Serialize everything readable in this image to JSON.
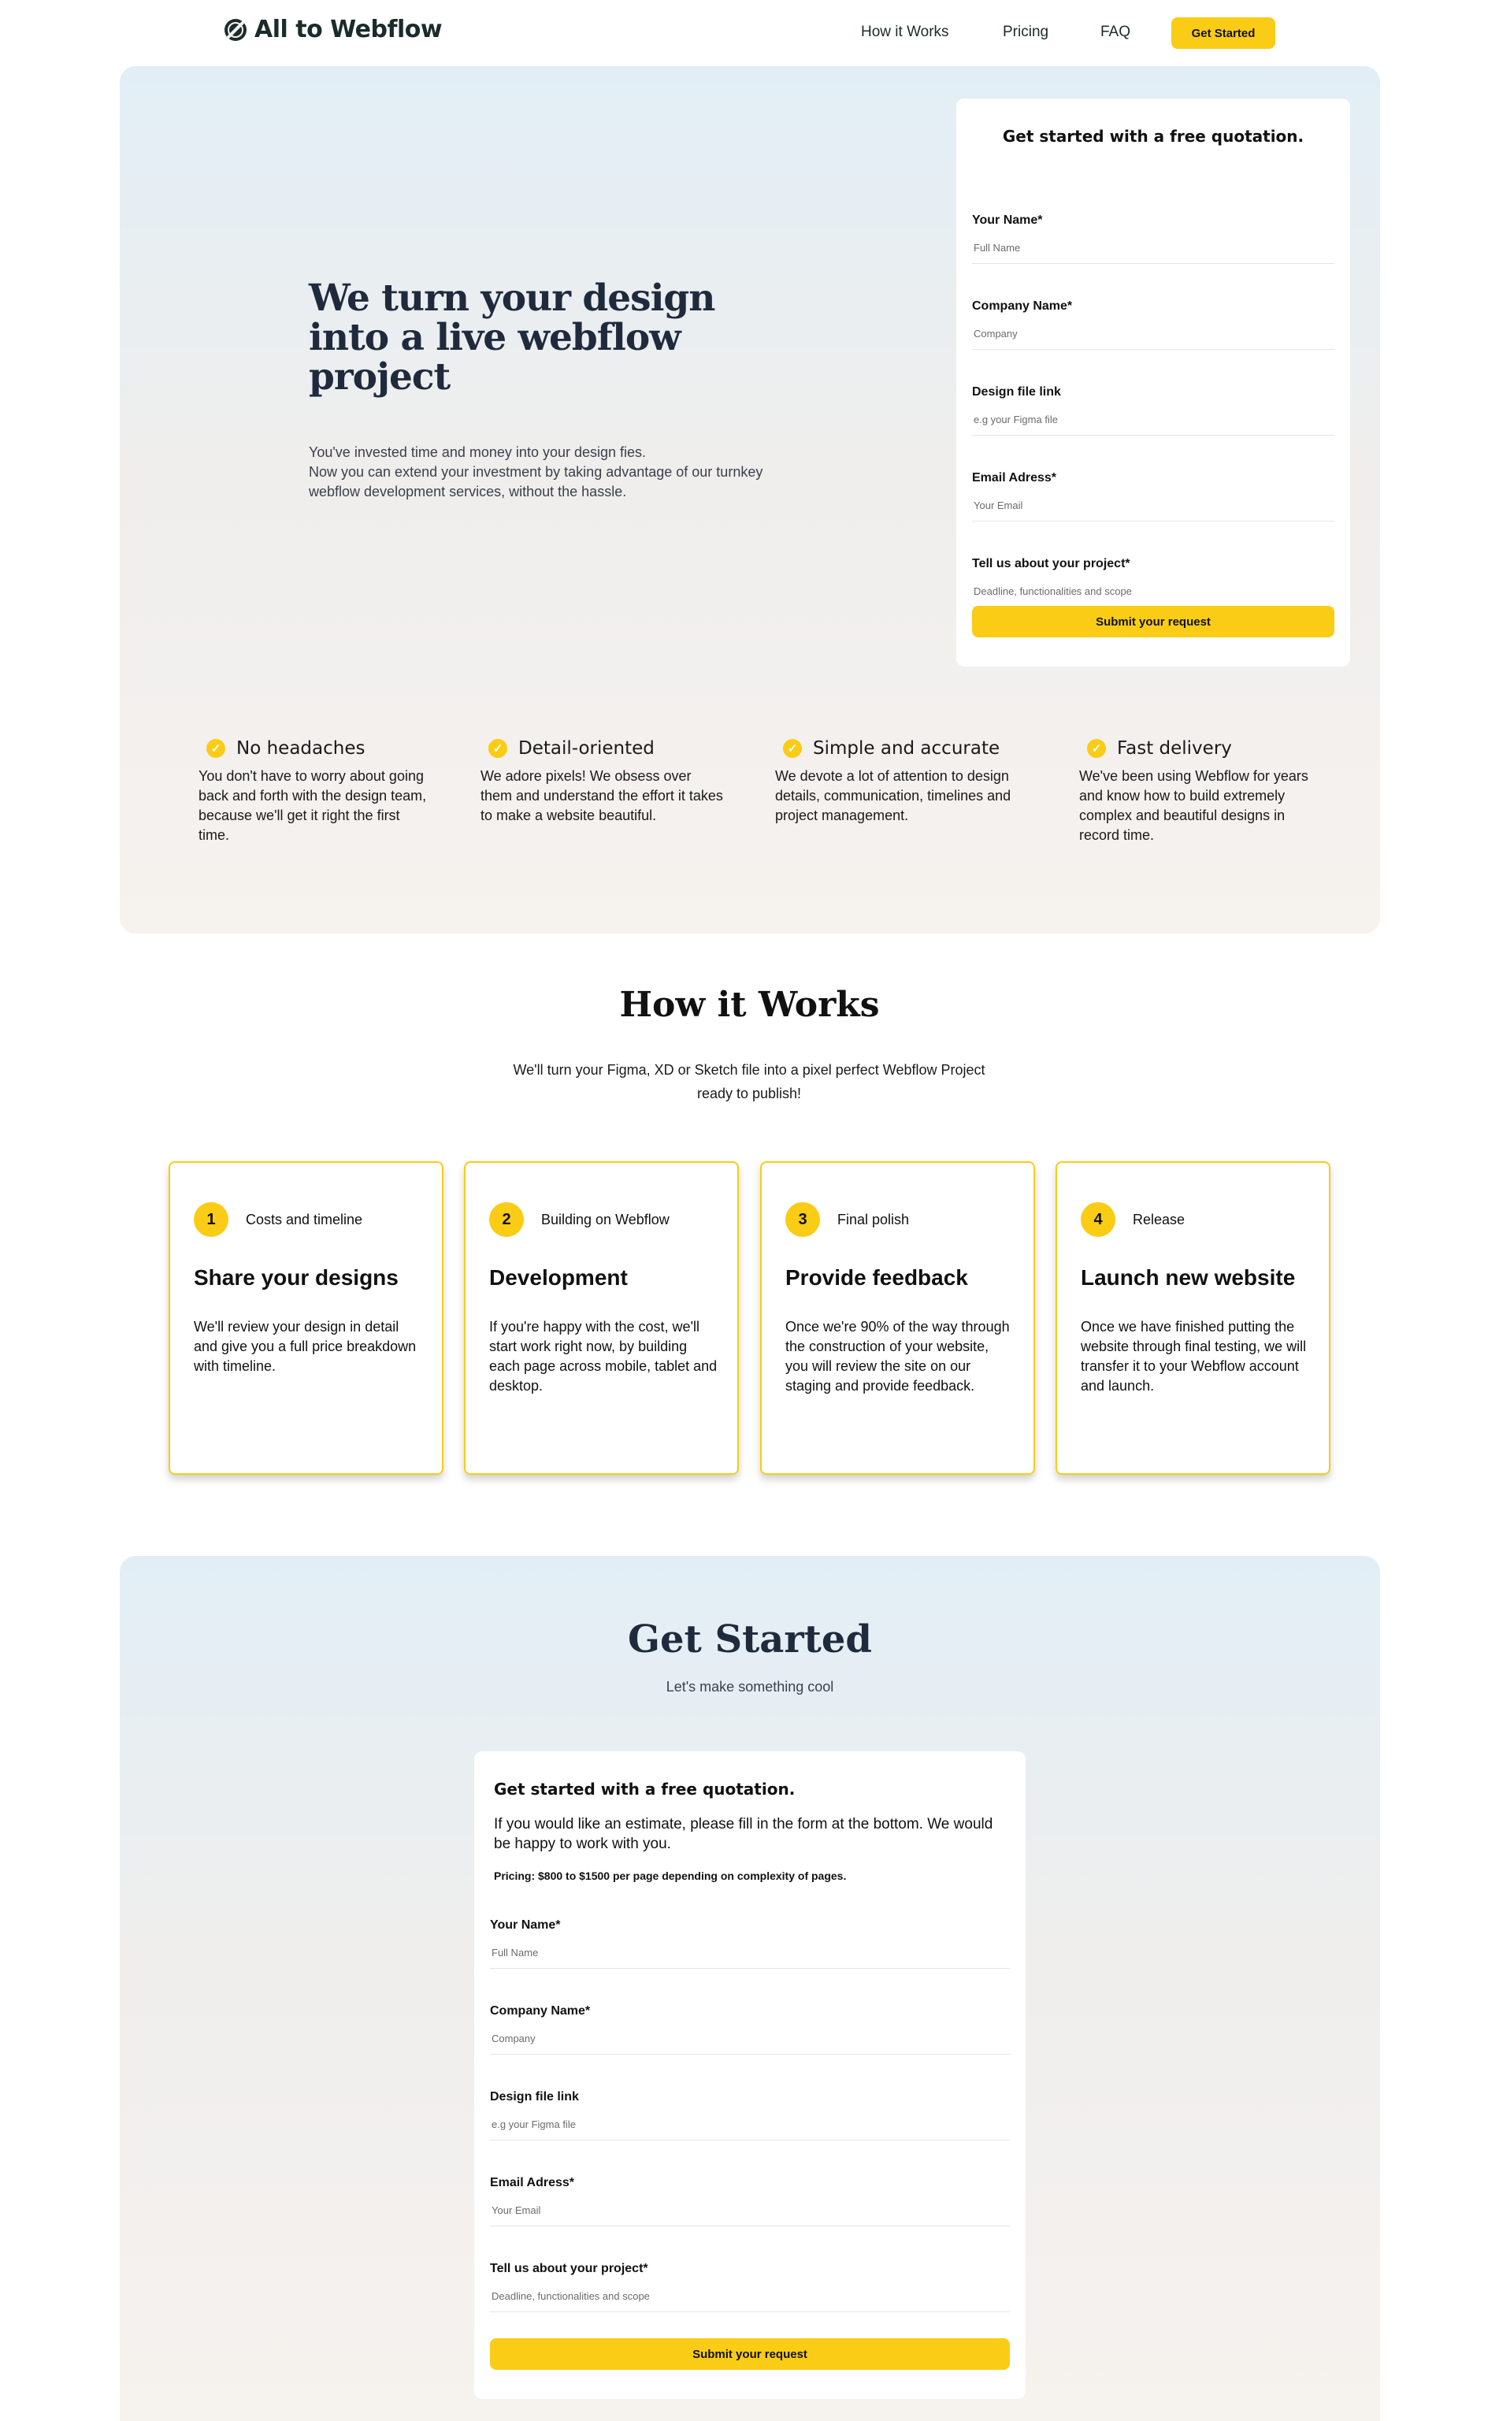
{
  "nav": {
    "logo_text": "All to Webflow",
    "links": [
      "How it Works",
      "Pricing",
      "FAQ"
    ],
    "cta_label": "Get Started",
    "logo_icon": "globe-icon"
  },
  "hero": {
    "title": "We turn your design into a live webflow project",
    "subtitle_lines": [
      "You've invested time and money into your design fies.",
      "Now you can extend your investment by taking advantage of our turnkey",
      "webflow development services, without the hassle."
    ],
    "form": {
      "title": "Get started with a free quotation.",
      "fields": [
        {
          "label": "Your Name*",
          "placeholder": "Full Name"
        },
        {
          "label": "Company Name*",
          "placeholder": "Company"
        },
        {
          "label": "Design file link",
          "placeholder": "e.g your Figma file"
        },
        {
          "label": "Email Adress*",
          "placeholder": "Your Email"
        },
        {
          "label": "Tell us about your project*",
          "placeholder": "Deadline, functionalities and scope"
        }
      ],
      "submit_label": "Submit your request"
    },
    "features": [
      {
        "title": "No headaches",
        "text": "You don't have to worry about going back and forth with the design team, because we'll get it right the first time."
      },
      {
        "title": "Detail-oriented",
        "text": "We adore pixels! We obsess over them and understand the effort it takes to make a website beautiful."
      },
      {
        "title": "Simple and accurate",
        "text": "We devote a lot of attention to design details, communication, timelines and project management."
      },
      {
        "title": "Fast delivery",
        "text": "We've been using Webflow for years and know how to build extremely complex and beautiful designs in record time."
      }
    ],
    "check_glyph": "✓"
  },
  "how_it_works": {
    "title": "How it Works",
    "subtitle": "We'll turn your Figma, XD or Sketch file into a pixel perfect Webflow Project ready to publish!",
    "steps": [
      {
        "num": "1",
        "tag": "Costs and timeline",
        "title": "Share your designs",
        "text": "We'll review your design in detail and give you a full price breakdown with timeline."
      },
      {
        "num": "2",
        "tag": "Building on Webflow",
        "title": "Development",
        "text": "If you're happy with the cost, we'll start work right now, by building each page across mobile, tablet and desktop."
      },
      {
        "num": "3",
        "tag": "Final polish",
        "title": "Provide feedback",
        "text": "Once we're 90% of the way through the construction of your website, you will review the site on our staging and provide feedback."
      },
      {
        "num": "4",
        "tag": "Release",
        "title": "Launch new website",
        "text": "Once we have finished putting the website through final testing, we will transfer it to your Webflow account and launch."
      }
    ]
  },
  "get_started": {
    "title": "Get Started",
    "subtitle": "Let's make something cool",
    "card": {
      "title": "Get started with a free quotation.",
      "text": "If you would like an estimate, please fill in the form at the bottom. We would be happy to work with you.",
      "pricing": "Pricing: $800 to $1500 per page depending on complexity of pages.",
      "fields": [
        {
          "label": "Your Name*",
          "placeholder": "Full Name"
        },
        {
          "label": "Company Name*",
          "placeholder": "Company"
        },
        {
          "label": "Design file link",
          "placeholder": "e.g your Figma file"
        },
        {
          "label": "Email Adress*",
          "placeholder": "Your Email"
        },
        {
          "label": "Tell us about your project*",
          "placeholder": "Deadline, functionalities and scope"
        }
      ],
      "submit_label": "Submit your request"
    }
  },
  "colors": {
    "accent": "#facc15",
    "heading": "#1f2a3d",
    "bg_top": "#e2eef6",
    "bg_bottom": "#f6f2ee"
  }
}
